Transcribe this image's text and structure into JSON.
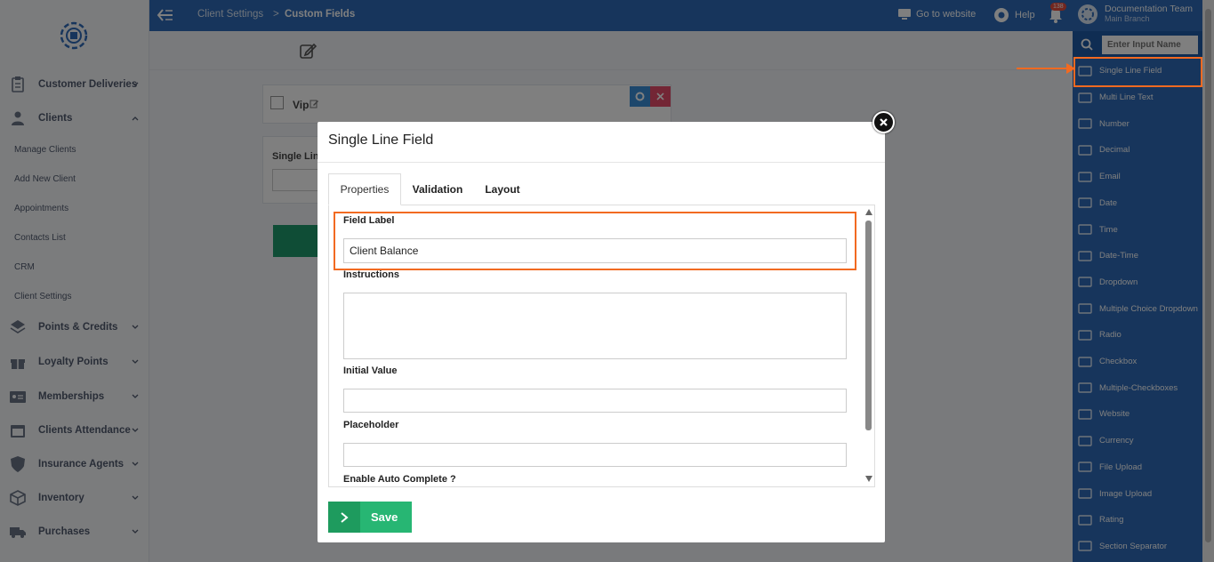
{
  "sidebar": {
    "items": [
      {
        "label": "Customer Deliveries"
      },
      {
        "label": "Clients"
      },
      {
        "label": "Points & Credits"
      },
      {
        "label": "Loyalty Points"
      },
      {
        "label": "Memberships"
      },
      {
        "label": "Clients Attendance"
      },
      {
        "label": "Insurance Agents"
      },
      {
        "label": "Inventory"
      },
      {
        "label": "Purchases"
      }
    ],
    "sub_items": [
      {
        "label": "Manage Clients"
      },
      {
        "label": "Add New Client"
      },
      {
        "label": "Appointments"
      },
      {
        "label": "Contacts List"
      },
      {
        "label": "CRM"
      },
      {
        "label": "Client Settings"
      }
    ]
  },
  "topbar": {
    "breadcrumb_1": "Client Settings",
    "breadcrumb_2": "Custom Fields",
    "go_to_website": "Go to website",
    "help": "Help",
    "notification_count": "138",
    "user_name": "Documentation Team",
    "branch": "Main Branch"
  },
  "content": {
    "field_vip_label": "Vip",
    "field_single_line_label": "Single Lin"
  },
  "palette": {
    "search_placeholder": "Enter Input Name",
    "items": [
      {
        "label": "Single Line Field"
      },
      {
        "label": "Multi Line Text"
      },
      {
        "label": "Number"
      },
      {
        "label": "Decimal"
      },
      {
        "label": "Email"
      },
      {
        "label": "Date"
      },
      {
        "label": "Time"
      },
      {
        "label": "Date-Time"
      },
      {
        "label": "Dropdown"
      },
      {
        "label": "Multiple Choice Dropdown"
      },
      {
        "label": "Radio"
      },
      {
        "label": "Checkbox"
      },
      {
        "label": "Multiple-Checkboxes"
      },
      {
        "label": "Website"
      },
      {
        "label": "Currency"
      },
      {
        "label": "File Upload"
      },
      {
        "label": "Image Upload"
      },
      {
        "label": "Rating"
      },
      {
        "label": "Section Separator"
      }
    ]
  },
  "modal": {
    "title": "Single Line Field",
    "tabs": [
      {
        "label": "Properties"
      },
      {
        "label": "Validation"
      },
      {
        "label": "Layout"
      }
    ],
    "field_label_label": "Field Label",
    "field_label_value": "Client Balance",
    "instructions_label": "Instructions",
    "initial_value_label": "Initial Value",
    "placeholder_label": "Placeholder",
    "auto_complete_label": "Enable Auto Complete ?",
    "save_label": "Save"
  },
  "colors": {
    "primary_blue": "#2e6bb8",
    "accent_orange": "#f26a21",
    "save_green": "#27b673"
  }
}
